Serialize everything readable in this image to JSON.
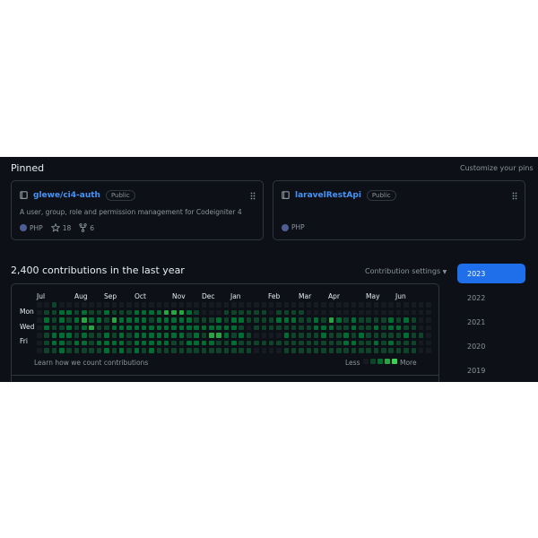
{
  "pinned": {
    "title": "Pinned",
    "customize_label": "Customize your pins",
    "repos": [
      {
        "name": "glewe/ci4-auth",
        "visibility": "Public",
        "description": "A user, group, role and permission management for Codeigniter 4",
        "language": "PHP",
        "language_color": "#4f5d95",
        "stars": "18",
        "forks": "6",
        "icons": [
          "repo-icon",
          "drag-handle-icon",
          "star-icon",
          "fork-icon"
        ]
      },
      {
        "name": "laravelRestApi",
        "visibility": "Public",
        "language": "PHP",
        "language_color": "#4f5d95",
        "icons": [
          "repo-icon",
          "drag-handle-icon"
        ]
      }
    ]
  },
  "contributions": {
    "title": "2,400 contributions in the last year",
    "settings_label": "Contribution settings",
    "months": [
      "Jul",
      "Aug",
      "Sep",
      "Oct",
      "Nov",
      "Dec",
      "Jan",
      "Feb",
      "Mar",
      "Apr",
      "May",
      "Jun"
    ],
    "days": [
      "Mon",
      "Wed",
      "Fri"
    ],
    "learn_label": "Learn how we count contributions",
    "less_label": "Less",
    "more_label": "More",
    "level_colors": [
      "#161b22",
      "#0e4429",
      "#006d32",
      "#26a641",
      "#39d353"
    ],
    "grid_levels": [
      "00100000000000000000000000000000000000000000000000000",
      "01122121121112222333210001111110111100000000000000000",
      "02121232213222212222211121221111222112132121111212100",
      "02112123112222222222222222210111111112221121121221100",
      "01222121121212222222121332121000021111211212111112110",
      "01221221222212222211222211211111111111111221121211100",
      "01121111121212121111111111111000011111111111111111100"
    ]
  },
  "years": [
    "2023",
    "2022",
    "2021",
    "2020",
    "2019"
  ],
  "active_year": "2023",
  "colors": {
    "background": "#0d1117",
    "border": "#30363d",
    "link": "#4493f8",
    "accent": "#1f6feb"
  }
}
